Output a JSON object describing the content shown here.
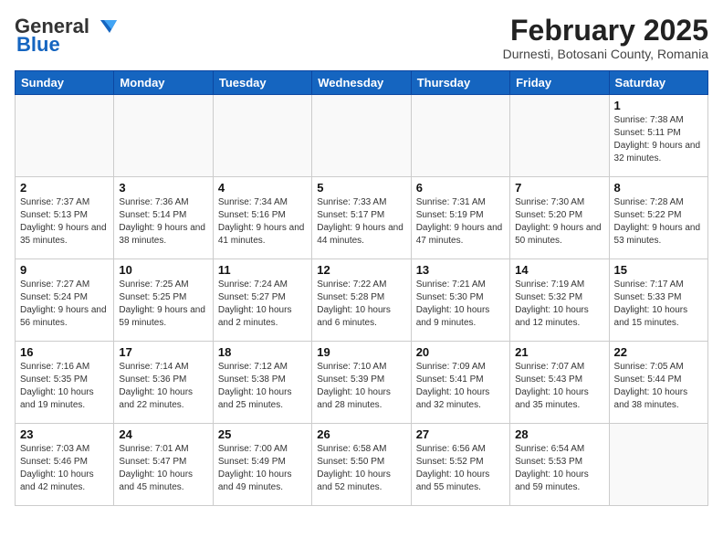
{
  "header": {
    "logo_general": "General",
    "logo_blue": "Blue",
    "month_title": "February 2025",
    "location": "Durnesti, Botosani County, Romania"
  },
  "days_of_week": [
    "Sunday",
    "Monday",
    "Tuesday",
    "Wednesday",
    "Thursday",
    "Friday",
    "Saturday"
  ],
  "weeks": [
    [
      {
        "day": "",
        "info": ""
      },
      {
        "day": "",
        "info": ""
      },
      {
        "day": "",
        "info": ""
      },
      {
        "day": "",
        "info": ""
      },
      {
        "day": "",
        "info": ""
      },
      {
        "day": "",
        "info": ""
      },
      {
        "day": "1",
        "info": "Sunrise: 7:38 AM\nSunset: 5:11 PM\nDaylight: 9 hours and 32 minutes."
      }
    ],
    [
      {
        "day": "2",
        "info": "Sunrise: 7:37 AM\nSunset: 5:13 PM\nDaylight: 9 hours and 35 minutes."
      },
      {
        "day": "3",
        "info": "Sunrise: 7:36 AM\nSunset: 5:14 PM\nDaylight: 9 hours and 38 minutes."
      },
      {
        "day": "4",
        "info": "Sunrise: 7:34 AM\nSunset: 5:16 PM\nDaylight: 9 hours and 41 minutes."
      },
      {
        "day": "5",
        "info": "Sunrise: 7:33 AM\nSunset: 5:17 PM\nDaylight: 9 hours and 44 minutes."
      },
      {
        "day": "6",
        "info": "Sunrise: 7:31 AM\nSunset: 5:19 PM\nDaylight: 9 hours and 47 minutes."
      },
      {
        "day": "7",
        "info": "Sunrise: 7:30 AM\nSunset: 5:20 PM\nDaylight: 9 hours and 50 minutes."
      },
      {
        "day": "8",
        "info": "Sunrise: 7:28 AM\nSunset: 5:22 PM\nDaylight: 9 hours and 53 minutes."
      }
    ],
    [
      {
        "day": "9",
        "info": "Sunrise: 7:27 AM\nSunset: 5:24 PM\nDaylight: 9 hours and 56 minutes."
      },
      {
        "day": "10",
        "info": "Sunrise: 7:25 AM\nSunset: 5:25 PM\nDaylight: 9 hours and 59 minutes."
      },
      {
        "day": "11",
        "info": "Sunrise: 7:24 AM\nSunset: 5:27 PM\nDaylight: 10 hours and 2 minutes."
      },
      {
        "day": "12",
        "info": "Sunrise: 7:22 AM\nSunset: 5:28 PM\nDaylight: 10 hours and 6 minutes."
      },
      {
        "day": "13",
        "info": "Sunrise: 7:21 AM\nSunset: 5:30 PM\nDaylight: 10 hours and 9 minutes."
      },
      {
        "day": "14",
        "info": "Sunrise: 7:19 AM\nSunset: 5:32 PM\nDaylight: 10 hours and 12 minutes."
      },
      {
        "day": "15",
        "info": "Sunrise: 7:17 AM\nSunset: 5:33 PM\nDaylight: 10 hours and 15 minutes."
      }
    ],
    [
      {
        "day": "16",
        "info": "Sunrise: 7:16 AM\nSunset: 5:35 PM\nDaylight: 10 hours and 19 minutes."
      },
      {
        "day": "17",
        "info": "Sunrise: 7:14 AM\nSunset: 5:36 PM\nDaylight: 10 hours and 22 minutes."
      },
      {
        "day": "18",
        "info": "Sunrise: 7:12 AM\nSunset: 5:38 PM\nDaylight: 10 hours and 25 minutes."
      },
      {
        "day": "19",
        "info": "Sunrise: 7:10 AM\nSunset: 5:39 PM\nDaylight: 10 hours and 28 minutes."
      },
      {
        "day": "20",
        "info": "Sunrise: 7:09 AM\nSunset: 5:41 PM\nDaylight: 10 hours and 32 minutes."
      },
      {
        "day": "21",
        "info": "Sunrise: 7:07 AM\nSunset: 5:43 PM\nDaylight: 10 hours and 35 minutes."
      },
      {
        "day": "22",
        "info": "Sunrise: 7:05 AM\nSunset: 5:44 PM\nDaylight: 10 hours and 38 minutes."
      }
    ],
    [
      {
        "day": "23",
        "info": "Sunrise: 7:03 AM\nSunset: 5:46 PM\nDaylight: 10 hours and 42 minutes."
      },
      {
        "day": "24",
        "info": "Sunrise: 7:01 AM\nSunset: 5:47 PM\nDaylight: 10 hours and 45 minutes."
      },
      {
        "day": "25",
        "info": "Sunrise: 7:00 AM\nSunset: 5:49 PM\nDaylight: 10 hours and 49 minutes."
      },
      {
        "day": "26",
        "info": "Sunrise: 6:58 AM\nSunset: 5:50 PM\nDaylight: 10 hours and 52 minutes."
      },
      {
        "day": "27",
        "info": "Sunrise: 6:56 AM\nSunset: 5:52 PM\nDaylight: 10 hours and 55 minutes."
      },
      {
        "day": "28",
        "info": "Sunrise: 6:54 AM\nSunset: 5:53 PM\nDaylight: 10 hours and 59 minutes."
      },
      {
        "day": "",
        "info": ""
      }
    ]
  ]
}
